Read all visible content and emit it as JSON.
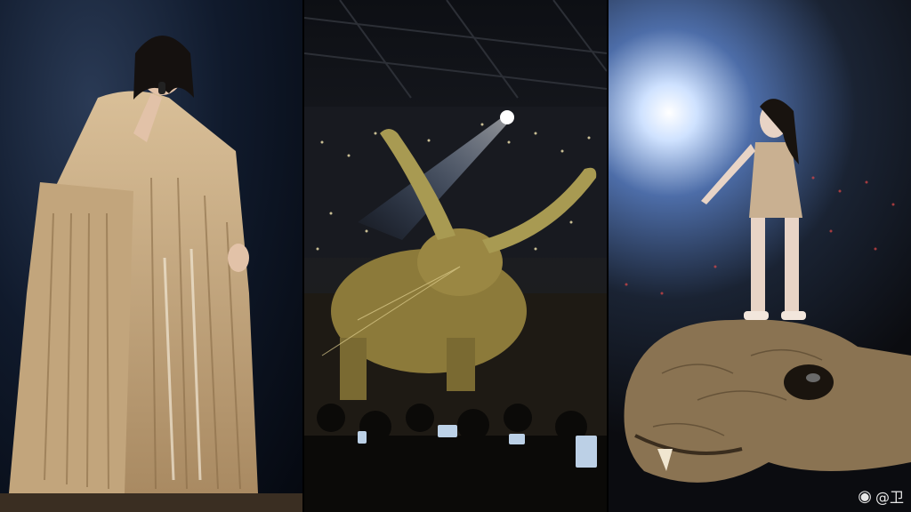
{
  "panels": [
    {
      "name": "singer-in-fringe-gown",
      "colors": {
        "backdrop": "#101a2c",
        "gown": "#cdb08a"
      }
    },
    {
      "name": "giant-bull-prop-stadium",
      "colors": {
        "bull": "#8c7a3a",
        "crowd_lights": "#f5e6b0"
      }
    },
    {
      "name": "singer-on-serpent-prop",
      "colors": {
        "spotlight": "#ffffff",
        "serpent": "#8a7352"
      }
    }
  ],
  "watermark": {
    "logo_icon": "weibo-logo-icon",
    "text": "@卫"
  }
}
